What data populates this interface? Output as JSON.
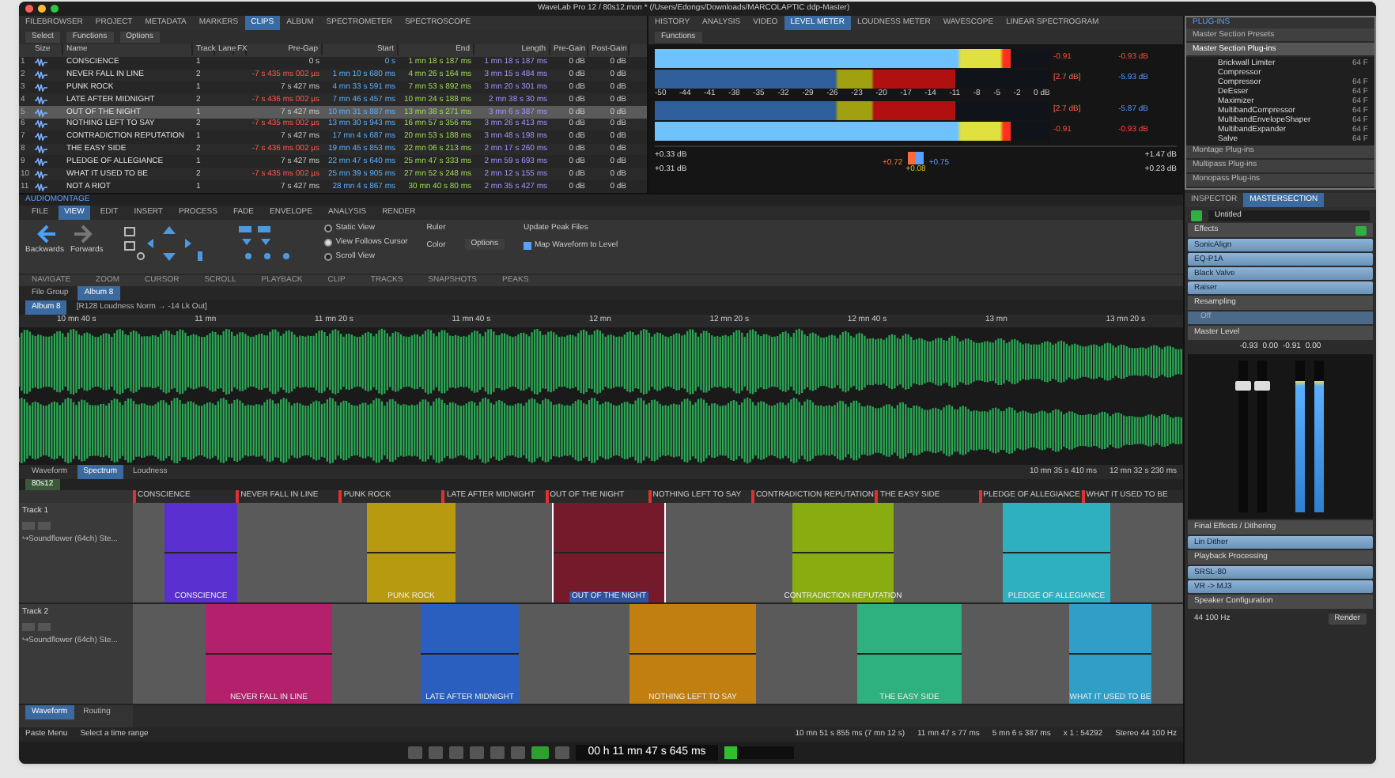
{
  "window": {
    "title": "WaveLab Pro 12 / 80s12.mon * (/Users/Edongs/Downloads/MARCOLAPTIC ddp-Master)"
  },
  "top_left_tabs": [
    {
      "label": "FILEBROWSER",
      "selected": false
    },
    {
      "label": "PROJECT",
      "selected": false
    },
    {
      "label": "METADATA",
      "selected": false
    },
    {
      "label": "MARKERS",
      "selected": false
    },
    {
      "label": "CLIPS",
      "selected": true
    },
    {
      "label": "ALBUM",
      "selected": false
    },
    {
      "label": "SPECTROMETER",
      "selected": false
    },
    {
      "label": "SPECTROSCOPE",
      "selected": false
    }
  ],
  "clips_toolbar": [
    "Select",
    "Functions",
    "Options"
  ],
  "clips_table": {
    "columns": [
      "Size",
      "Name",
      "Track",
      "Lane",
      "FX",
      "Pre-Gap",
      "Start",
      "End",
      "Length",
      "Pre-Gain",
      "Post-Gain"
    ],
    "rows": [
      {
        "index": "1",
        "name": "CONSCIENCE",
        "track": "1",
        "pre_gap": "0 s",
        "start": "0 s",
        "end": "1 mn 18 s 187 ms",
        "length": "1 mn 18 s 187 ms",
        "pre_gain": "0 dB",
        "post_gain": "0 dB",
        "selected": false
      },
      {
        "index": "2",
        "name": "NEVER FALL IN LINE",
        "track": "2",
        "pre_gap": "-7 s 435 ms 002 µs",
        "start": "1 mn 10 s 680 ms",
        "end": "4 mn 26 s 164 ms",
        "length": "3 mn 15 s 484 ms",
        "pre_gain": "0 dB",
        "post_gain": "0 dB",
        "selected": false
      },
      {
        "index": "3",
        "name": "PUNK ROCK",
        "track": "1",
        "pre_gap": "7 s 427 ms",
        "start": "4 mn 33 s 591 ms",
        "end": "7 mn 53 s 892 ms",
        "length": "3 mn 20 s 301 ms",
        "pre_gain": "0 dB",
        "post_gain": "0 dB",
        "selected": false
      },
      {
        "index": "4",
        "name": "LATE AFTER MIDNIGHT",
        "track": "2",
        "pre_gap": "-7 s 436 ms 002 µs",
        "start": "7 mn 46 s 457 ms",
        "end": "10 mn 24 s 188 ms",
        "length": "2 mn 38 s 30 ms",
        "pre_gain": "0 dB",
        "post_gain": "0 dB",
        "selected": false
      },
      {
        "index": "5",
        "name": "OUT OF THE NIGHT",
        "track": "1",
        "pre_gap": "7 s 427 ms",
        "start": "10 mn 31 s 887 ms",
        "end": "13 mn 38 s 271 ms",
        "length": "3 mn 6 s 387 ms",
        "pre_gain": "0 dB",
        "post_gain": "0 dB",
        "selected": true
      },
      {
        "index": "6",
        "name": "NOTHING LEFT TO SAY",
        "track": "2",
        "pre_gap": "-7 s 435 ms 002 µs",
        "start": "13 mn 30 s 943 ms",
        "end": "16 mn 57 s 356 ms",
        "length": "3 mn 26 s 413 ms",
        "pre_gain": "0 dB",
        "post_gain": "0 dB",
        "selected": false
      },
      {
        "index": "7",
        "name": "CONTRADICTION REPUTATION",
        "track": "1",
        "pre_gap": "7 s 427 ms",
        "start": "17 mn 4 s 687 ms",
        "end": "20 mn 53 s 188 ms",
        "length": "3 mn 48 s 198 ms",
        "pre_gain": "0 dB",
        "post_gain": "0 dB",
        "selected": false
      },
      {
        "index": "8",
        "name": "THE EASY SIDE",
        "track": "2",
        "pre_gap": "-7 s 436 ms 002 µs",
        "start": "19 mn 45 s 853 ms",
        "end": "22 mn 06 s 213 ms",
        "length": "2 mn 17 s 260 ms",
        "pre_gain": "0 dB",
        "post_gain": "0 dB",
        "selected": false
      },
      {
        "index": "9",
        "name": "PLEDGE OF ALLEGIANCE",
        "track": "1",
        "pre_gap": "7 s 427 ms",
        "start": "22 mn 47 s 640 ms",
        "end": "25 mn 47 s 333 ms",
        "length": "2 mn 59 s 693 ms",
        "pre_gain": "0 dB",
        "post_gain": "0 dB",
        "selected": false
      },
      {
        "index": "10",
        "name": "WHAT IT USED TO BE",
        "track": "2",
        "pre_gap": "-7 s 435 ms 002 µs",
        "start": "25 mn 39 s 905 ms",
        "end": "27 mn 52 s 248 ms",
        "length": "2 mn 12 s 155 ms",
        "pre_gain": "0 dB",
        "post_gain": "0 dB",
        "selected": false
      },
      {
        "index": "11",
        "name": "NOT A RIOT",
        "track": "1",
        "pre_gap": "7 s 427 ms",
        "start": "28 mn 4 s 867 ms",
        "end": "30 mn 40 s 80 ms",
        "length": "2 mn 35 s 427 ms",
        "pre_gain": "0 dB",
        "post_gain": "0 dB",
        "selected": false
      }
    ]
  },
  "meter_tabs": [
    {
      "label": "HISTORY",
      "selected": false
    },
    {
      "label": "ANALYSIS",
      "selected": false
    },
    {
      "label": "VIDEO",
      "selected": false
    },
    {
      "label": "LEVEL METER",
      "selected": true
    },
    {
      "label": "LOUDNESS METER",
      "selected": false
    },
    {
      "label": "WAVESCOPE",
      "selected": false
    },
    {
      "label": "LINEAR SPECTROGRAM",
      "selected": false
    }
  ],
  "meter_toolbar": {
    "label": "Functions"
  },
  "level_meter": {
    "bars": [
      {
        "kind": "peak",
        "level": 0.9,
        "marker": "-0.91",
        "reading": "-0.93 dB"
      },
      {
        "kind": "rms",
        "level": 0.76,
        "marker": "[2.7 dB]",
        "reading": "-5.93 dB"
      },
      {
        "kind": "rms",
        "level": 0.76,
        "marker": "[2.7 dB]",
        "reading": "-5.87 dB"
      },
      {
        "kind": "peak",
        "level": 0.9,
        "marker": "-0.91",
        "reading": "-0.93 dB"
      }
    ],
    "scale": [
      "-50",
      "-44",
      "-41",
      "-38",
      "-35",
      "-32",
      "-29",
      "-26",
      "-23",
      "-20",
      "-17",
      "-14",
      "-11",
      "-8",
      "-5",
      "-2",
      "0 dB"
    ],
    "left_readings": [
      "+0.33 dB",
      "+0.31 dB"
    ],
    "pan_readings": [
      "+0.72",
      "+0.75",
      "+0.08"
    ],
    "right_readings": [
      "+1.47 dB",
      "+0.23 dB"
    ]
  },
  "plugins": {
    "title": "PLUG-INS",
    "sections": [
      {
        "label": "Master Section Presets",
        "expanded": false
      },
      {
        "label": "Master Section Plug-ins",
        "expanded": true
      }
    ],
    "items": [
      {
        "name": "Brickwall Limiter",
        "tag": "64 F"
      },
      {
        "name": "Compressor"
      },
      {
        "name": "Compressor",
        "tag": "64 F"
      },
      {
        "name": "DeEsser",
        "tag": "64 F"
      },
      {
        "name": "Maximizer",
        "tag": "64 F"
      },
      {
        "name": "MultibandCompressor",
        "tag": "64 F"
      },
      {
        "name": "MultibandEnvelopeShaper",
        "tag": "64 F"
      },
      {
        "name": "MultibandExpander",
        "tag": "64 F"
      },
      {
        "name": "Salve",
        "tag": "64 F"
      }
    ],
    "footer_sections": [
      "Montage Plug-ins",
      "Multipass Plug-ins",
      "Monopass Plug-ins"
    ]
  },
  "inspector": {
    "tabs": [
      {
        "label": "INSPECTOR",
        "selected": false
      },
      {
        "label": "MASTERSECTION",
        "selected": true
      }
    ],
    "preset": "Untitled",
    "effects": {
      "title": "Effects",
      "on": true,
      "slots": [
        "SonicAlign",
        "EQ-P1A",
        "Black Valve",
        "Raiser"
      ]
    },
    "resampling": {
      "title": "Resampling",
      "value": "Off"
    },
    "master_level": {
      "title": "Master Level",
      "readings": [
        "-0.93",
        "0.00",
        "-0.91",
        "0.00"
      ],
      "faders": [
        {
          "level": 0.8
        },
        {
          "level": 0.8
        }
      ],
      "meters": [
        {
          "level": 0.86
        },
        {
          "level": 0.86
        }
      ]
    },
    "final_effects": {
      "title": "Final Effects / Dithering",
      "slots": [
        "Lin Dither"
      ]
    },
    "playback": {
      "title": "Playback Processing",
      "slots": [
        "SRSL-80",
        "VR -> MJ3"
      ]
    },
    "speaker": {
      "title": "Speaker Configuration"
    },
    "sample_rate": "44 100 Hz",
    "render": "Render"
  },
  "montage_label": "AUDIOMONTAGE",
  "ribbon": {
    "tabs": [
      {
        "label": "FILE",
        "selected": false
      },
      {
        "label": "VIEW",
        "selected": true
      },
      {
        "label": "EDIT",
        "selected": false
      },
      {
        "label": "INSERT",
        "selected": false
      },
      {
        "label": "PROCESS",
        "selected": false
      },
      {
        "label": "FADE",
        "selected": false
      },
      {
        "label": "ENVELOPE",
        "selected": false
      },
      {
        "label": "ANALYSIS",
        "selected": false
      },
      {
        "label": "RENDER",
        "selected": false
      }
    ],
    "nav": [
      "Backwards",
      "Forwards"
    ],
    "playback_options": [
      {
        "label": "Static View",
        "selected": false
      },
      {
        "label": "View Follows Cursor",
        "selected": true
      },
      {
        "label": "Scroll View",
        "selected": false
      }
    ],
    "clip_items": [
      "Ruler",
      "Color"
    ],
    "options": "Options",
    "peaks": {
      "update": "Update Peak Files",
      "map_label": "Map Waveform to Level",
      "map_checked": true
    },
    "groups": [
      "NAVIGATE",
      "ZOOM",
      "CURSOR",
      "SCROLL",
      "PLAYBACK",
      "CLIP",
      "TRACKS",
      "SNAPSHOTS",
      "PEAKS"
    ]
  },
  "file_tabs": [
    {
      "label": "File Group",
      "selected": false
    },
    {
      "label": "Album 8",
      "selected": true
    }
  ],
  "wave_tabs": [
    {
      "label": "Album 8",
      "selected": true
    },
    {
      "label": "[R128 Loudness Norm → -14 Lk Out]",
      "selected": false
    }
  ],
  "waveform": {
    "times": [
      "10 mn 40 s",
      "11 mn",
      "11 mn 20 s",
      "11 mn 40 s",
      "12 mn",
      "12 mn 20 s",
      "12 mn 40 s",
      "13 mn",
      "13 mn 20 s"
    ],
    "view_tabs": [
      {
        "label": "Waveform",
        "selected": false
      },
      {
        "label": "Spectrum",
        "selected": true
      },
      {
        "label": "Loudness",
        "selected": false
      }
    ],
    "status": [
      "10 mn 35 s 410 ms",
      "12 mn 32 s 230 ms"
    ]
  },
  "montage": {
    "tab": "80s12",
    "markers": [
      "CONSCIENCE",
      "NEVER FALL IN LINE",
      "PUNK ROCK",
      "LATE AFTER MIDNIGHT",
      "OUT OF THE NIGHT",
      "NOTHING LEFT TO SAY",
      "CONTRADICTION REPUTATION",
      "THE EASY SIDE",
      "PLEDGE OF ALLEGIANCE",
      "WHAT IT USED TO BE"
    ],
    "tracks": [
      {
        "name": "Track 1",
        "output": "↪Soundflower (64ch) Ste...",
        "clips": [
          {
            "name": "CONSCIENCE",
            "color": "#5a2fd0",
            "selected": false
          },
          {
            "name": "PUNK ROCK",
            "color": "#b89a10",
            "selected": false
          },
          {
            "name": "OUT OF THE NIGHT",
            "color": "#751a2a",
            "selected": true
          },
          {
            "name": "CONTRADICTION REPUTATION",
            "color": "#89ad10",
            "selected": false
          },
          {
            "name": "PLEDGE OF ALLEGIANCE",
            "color": "#2fb0c0",
            "selected": false
          }
        ]
      },
      {
        "name": "Track 2",
        "output": "↪Soundflower (64ch) Ste...",
        "clips": [
          {
            "name": "NEVER FALL IN LINE",
            "color": "#b3206c",
            "selected": false
          },
          {
            "name": "LATE AFTER MIDNIGHT",
            "color": "#2a5fc0",
            "selected": false
          },
          {
            "name": "NOTHING LEFT TO SAY",
            "color": "#c07f10",
            "selected": false
          },
          {
            "name": "THE EASY SIDE",
            "color": "#2fb07f",
            "selected": false
          },
          {
            "name": "WHAT IT USED TO BE",
            "color": "#2f9fc8",
            "selected": false
          }
        ]
      }
    ],
    "bottom_tabs": [
      {
        "label": "Waveform",
        "selected": true
      },
      {
        "label": "Routing",
        "selected": false
      }
    ],
    "status": [
      "Paste Menu",
      "Select a time range"
    ],
    "status_right": [
      "10 mn 51 s 855 ms (7 mn 12 s)",
      "11 mn 47 s 77 ms",
      "5 mn 6 s 387 ms",
      "x 1 : 54292",
      "Stereo 44 100 Hz"
    ]
  },
  "transport": {
    "time": "00 h 11 mn 47 s 645 ms",
    "playing": true
  }
}
